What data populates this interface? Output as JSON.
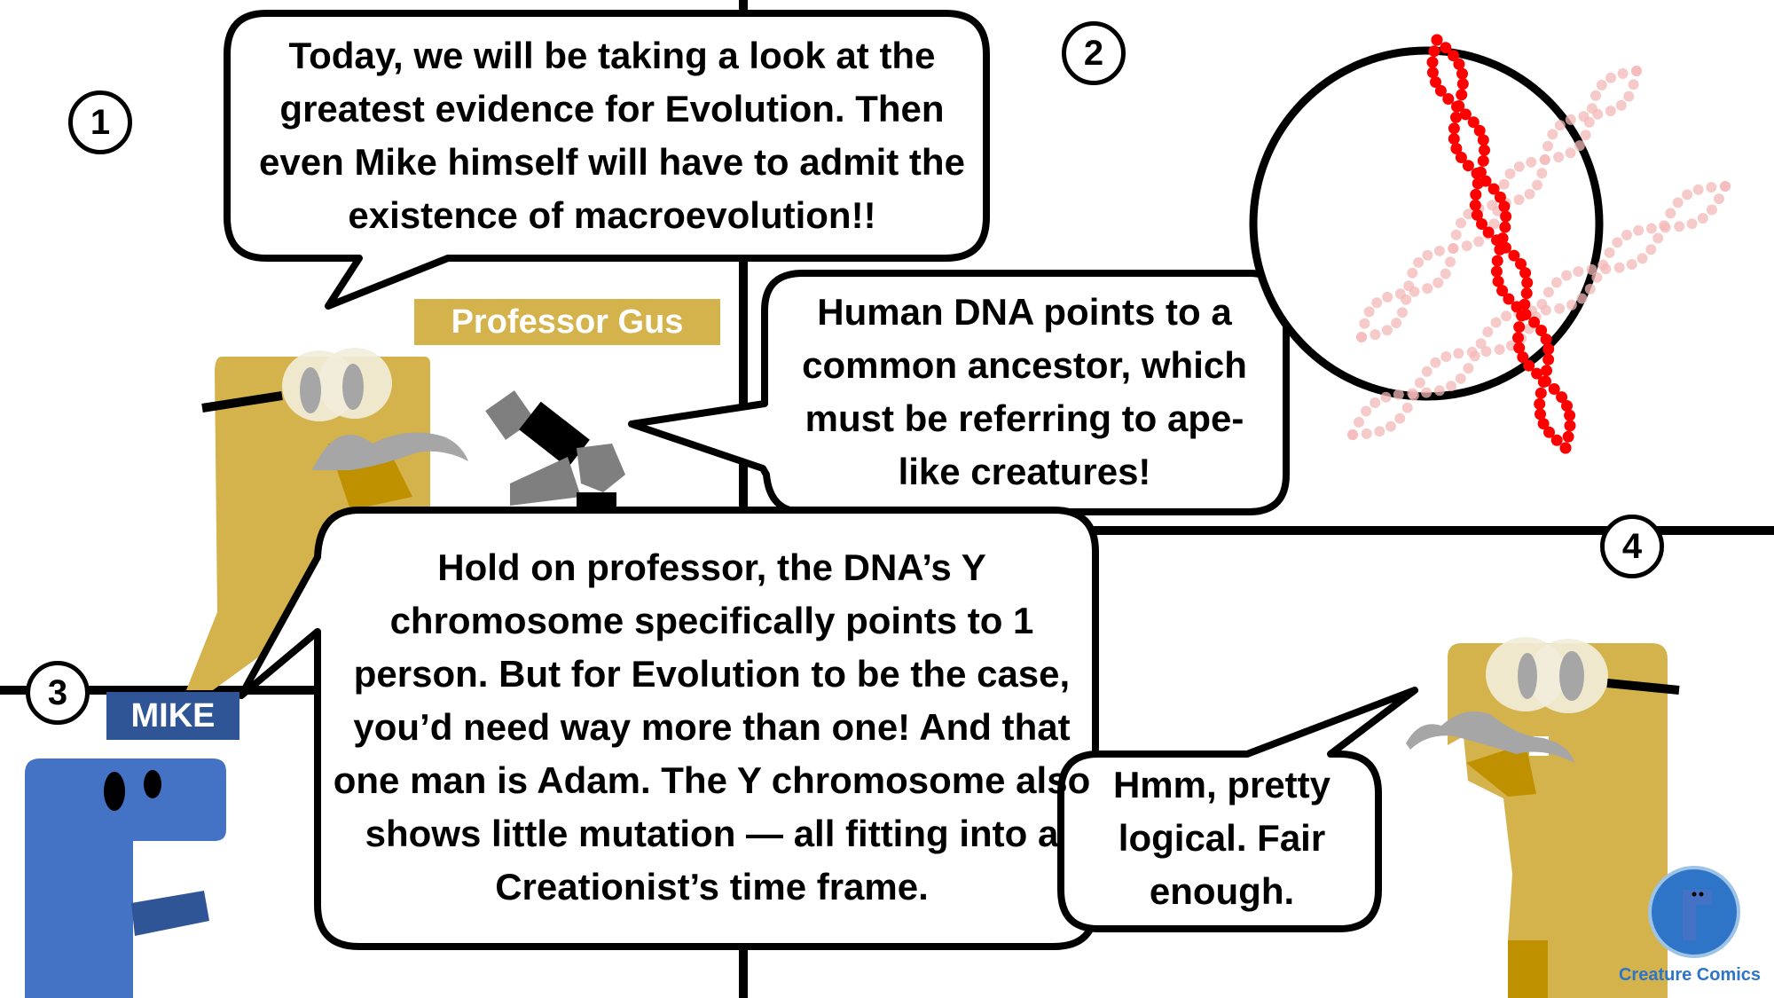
{
  "panels": {
    "panel1": {
      "number": "1",
      "speaker": "Professor Gus",
      "text": "Today, we will be taking a look at the greatest evidence for Evolution. Then even Mike himself will have to admit the existence of macroevolution!!"
    },
    "panel2": {
      "number": "2",
      "text": "Human DNA points to a common ancestor, which must be referring to ape-like creatures!"
    },
    "panel3": {
      "number": "3",
      "speaker": "MIKE",
      "text": "Hold on professor, the DNA’s Y chromosome specifically points to 1 person. But for Evolution to be the case, you’d need way more than one! And that one man is Adam. The Y chromosome also shows little mutation — all fitting into a Creationist’s time frame."
    },
    "panel4": {
      "number": "4",
      "text": "Hmm, pretty logical. Fair enough."
    }
  },
  "branding": {
    "name": "Creature Comics"
  },
  "colors": {
    "gus_body": "#d4b24c",
    "gus_shadow": "#bf9000",
    "mike_body": "#4472c4",
    "mike_accent": "#2f5597",
    "dna_main": "#ff0000",
    "dna_faded": "#f4b8b8",
    "mustache": "#a6a6a6"
  },
  "icons": [
    "microscope-icon",
    "dna-helix-icon",
    "creature-comics-logo"
  ]
}
